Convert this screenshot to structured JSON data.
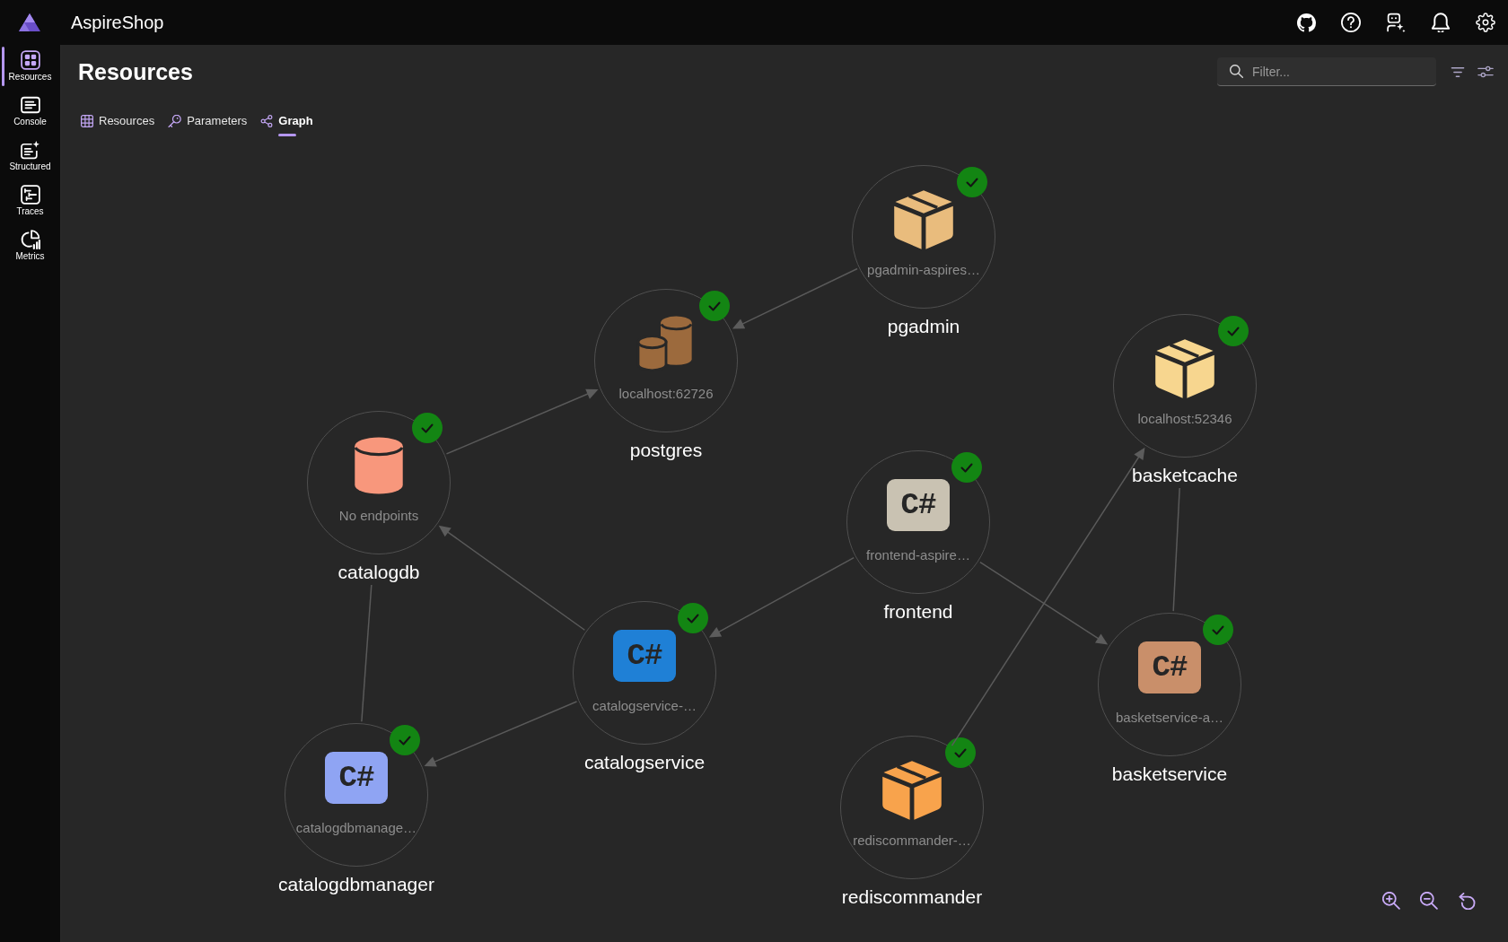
{
  "app": {
    "title": "AspireShop"
  },
  "sidebar": {
    "items": [
      {
        "label": "Resources",
        "selected": true
      },
      {
        "label": "Console",
        "selected": false
      },
      {
        "label": "Structured",
        "selected": false
      },
      {
        "label": "Traces",
        "selected": false
      },
      {
        "label": "Metrics",
        "selected": false
      }
    ]
  },
  "page": {
    "title": "Resources",
    "filter": {
      "placeholder": "Filter..."
    }
  },
  "view_tabs": [
    {
      "label": "Resources",
      "selected": false
    },
    {
      "label": "Parameters",
      "selected": false
    },
    {
      "label": "Graph",
      "selected": true
    }
  ],
  "graph": {
    "nodes": [
      {
        "name": "pgadmin",
        "endpoint": "pgadmin-aspires…",
        "kind": "container",
        "color": "#e9bc7d",
        "running": true
      },
      {
        "name": "postgres",
        "endpoint": "localhost:62726",
        "kind": "server",
        "color": "#9c6a3d",
        "running": true
      },
      {
        "name": "basketcache",
        "endpoint": "localhost:52346",
        "kind": "container",
        "color": "#f7d68f",
        "running": true
      },
      {
        "name": "catalogdb",
        "endpoint": "No endpoints",
        "kind": "database",
        "color": "#f8977c",
        "running": true
      },
      {
        "name": "frontend",
        "endpoint": "frontend-aspire…",
        "kind": "project",
        "icon_text": "C#",
        "color": "#c9c2b2",
        "running": true
      },
      {
        "name": "catalogservice",
        "endpoint": "catalogservice-…",
        "kind": "project",
        "icon_text": "C#",
        "color": "#1f80d6",
        "running": true
      },
      {
        "name": "basketservice",
        "endpoint": "basketservice-a…",
        "kind": "project",
        "icon_text": "C#",
        "color": "#c98f6a",
        "running": true
      },
      {
        "name": "catalogdbmanager",
        "endpoint": "catalogdbmanage…",
        "kind": "project",
        "icon_text": "C#",
        "color": "#8fa4f3",
        "running": true
      },
      {
        "name": "rediscommander",
        "endpoint": "rediscommander-…",
        "kind": "container",
        "color": "#f8a34c",
        "running": true
      }
    ],
    "edges": [
      {
        "arrow": true
      },
      {
        "arrow": true
      },
      {
        "arrow": true
      },
      {
        "arrow": true
      },
      {
        "arrow": true
      },
      {
        "arrow": true
      },
      {
        "arrow": true
      },
      {
        "arrow": false
      },
      {
        "arrow": false
      }
    ]
  }
}
